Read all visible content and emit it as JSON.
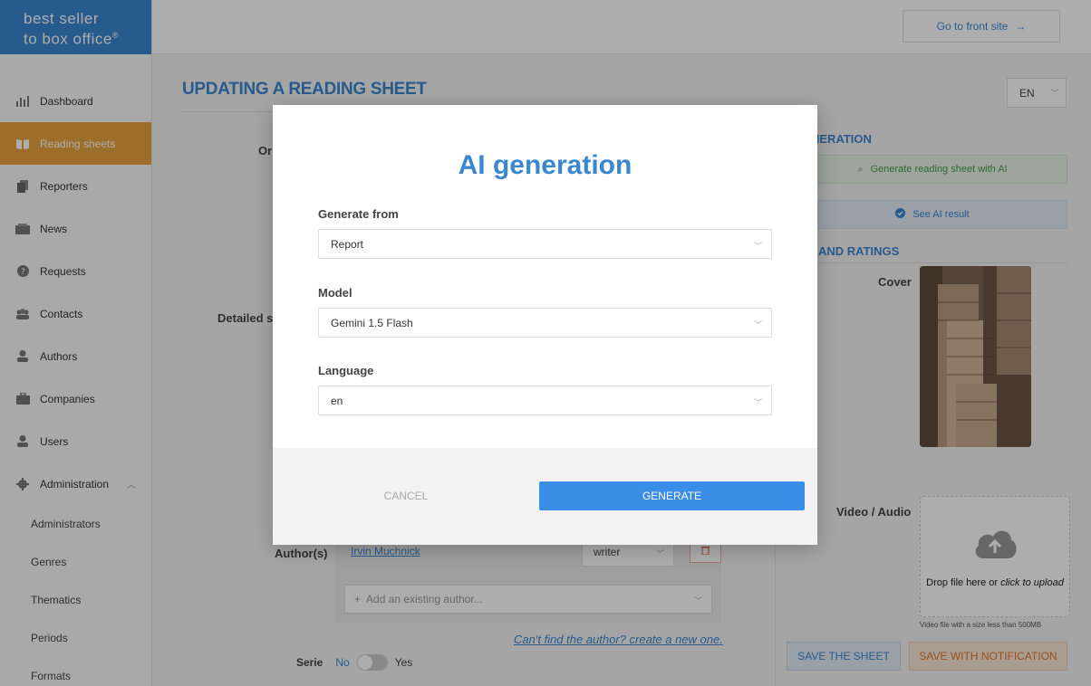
{
  "brand": {
    "line1": "best seller",
    "line2": "to box office",
    "mark": "®"
  },
  "topbar": {
    "front_site_label": "Go to front site",
    "front_site_arrow": "→"
  },
  "sidebar": {
    "items": [
      {
        "label": "Dashboard",
        "icon": "bar-chart-icon"
      },
      {
        "label": "Reading sheets",
        "icon": "book-icon"
      },
      {
        "label": "Reporters",
        "icon": "documents-icon"
      },
      {
        "label": "News",
        "icon": "newspaper-icon"
      },
      {
        "label": "Requests",
        "icon": "question-icon"
      },
      {
        "label": "Contacts",
        "icon": "people-icon"
      },
      {
        "label": "Authors",
        "icon": "user-icon"
      },
      {
        "label": "Companies",
        "icon": "briefcase-icon"
      },
      {
        "label": "Users",
        "icon": "user-icon"
      },
      {
        "label": "Administration",
        "icon": "gear-icon"
      }
    ],
    "sub_items": [
      "Administrators",
      "Genres",
      "Thematics",
      "Periods",
      "Formats"
    ]
  },
  "page": {
    "title": "UPDATING A READING SHEET",
    "lang": "EN",
    "label_ori": "Ori",
    "label_detailed": "Detailed s",
    "label_authors": "Author(s)",
    "label_serie": "Serie",
    "serie_no": "No",
    "serie_yes": "Yes"
  },
  "right_panel": {
    "generation_title": "NERATION",
    "ai_generate_label": "Generate reading sheet with AI",
    "see_ai_label": "See AI result",
    "ratings_title": "AND RATINGS",
    "cover_label": "Cover",
    "video_label": "Video / Audio",
    "upload_text_plain": "Drop file here or ",
    "upload_text_italic": "click to upload",
    "upload_hint": "Video file with a size less than 500MB",
    "save_label": "SAVE THE SHEET",
    "save_notify_label": "SAVE WITH NOTIFICATION"
  },
  "authors": {
    "entries": [
      {
        "name": "Irvin Muchnick",
        "role": "writer"
      }
    ],
    "add_placeholder": "Add an existing author...",
    "create_link": "Can't find the author? create a new one."
  },
  "modal": {
    "title": "AI generation",
    "fields": [
      {
        "label": "Generate from",
        "value": "Report"
      },
      {
        "label": "Model",
        "value": "Gemini 1.5 Flash"
      },
      {
        "label": "Language",
        "value": "en"
      }
    ],
    "cancel_label": "CANCEL",
    "generate_label": "GENERATE"
  }
}
